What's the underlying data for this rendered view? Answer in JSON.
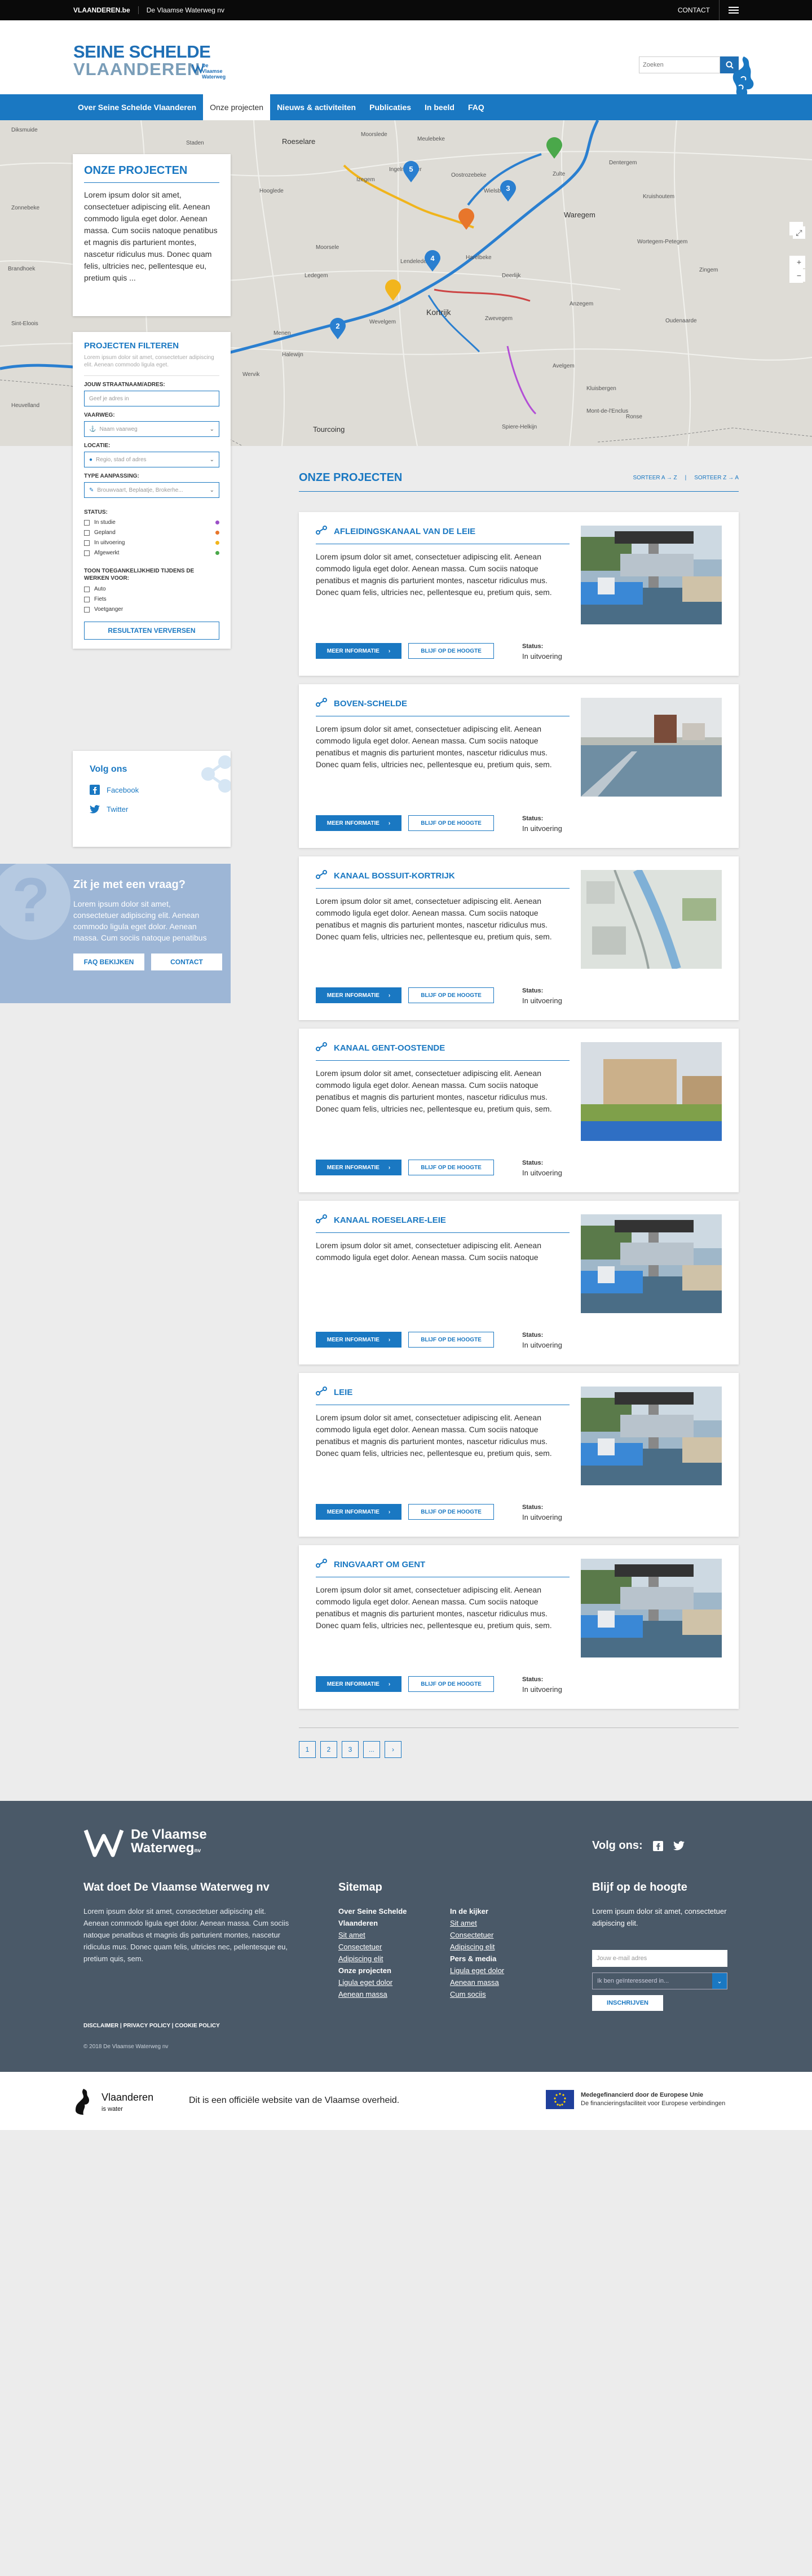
{
  "topbar": {
    "vlaanderen": "VLAANDEREN.be",
    "org": "De Vlaamse Waterweg nv",
    "contact": "CONTACT"
  },
  "header": {
    "title_line1": "SEINE SCHELDE",
    "title_line2": "VLAANDEREN",
    "partner": "De Vlaamse Waterweg",
    "search_placeholder": "Zoeken"
  },
  "nav": [
    "Over Seine Schelde Vlaanderen",
    "Onze projecten",
    "Nieuws & activiteiten",
    "Publicaties",
    "In beeld",
    "FAQ"
  ],
  "map": {
    "labels": [
      "Diksmuide",
      "Staden",
      "Roeselare",
      "Moorslede",
      "Meulebeke",
      "Oostrozebeke",
      "Zulte",
      "Izegem",
      "Wielsbeke",
      "Waregem",
      "Dentergem",
      "Ingelmunster",
      "Wervik",
      "Kortrijk",
      "Harelbeke",
      "Zwevegem",
      "Menen",
      "Wevelgem",
      "Deerlijk",
      "Avelgem",
      "Tourcoing",
      "Ronse",
      "Oudenaarde",
      "Anzegem",
      "Kluisbergen",
      "Spiere-Helkijn",
      "Sint-Eloois",
      "Halewijn",
      "Lendelede",
      "Hooglede",
      "Ledegem",
      "Moorsele",
      "Heuvelland",
      "Zonnebeke",
      "Kruishoutem",
      "Wortegem-Petegem",
      "Zingem",
      "Brandhoek",
      "Mont-de-l'Enclus"
    ],
    "markers": [
      "5",
      "3",
      "4",
      "2"
    ]
  },
  "intro": {
    "title": "ONZE PROJECTEN",
    "text": "Lorem ipsum dolor sit amet, consectetuer adipiscing elit. Aenean commodo ligula eget dolor. Aenean massa. Cum sociis natoque penatibus et magnis dis parturient montes, nascetur ridiculus mus. Donec quam felis, ultricies nec, pellentesque eu, pretium quis ..."
  },
  "filter": {
    "title": "PROJECTEN FILTEREN",
    "sub": "Lorem ipsum dolor sit amet, consectetuer adipiscing elit. Aenean commodo ligula eget.",
    "address_label": "JOUW STRAATNAAM/ADRES:",
    "address_placeholder": "Geef je adres in",
    "waterway_label": "VAARWEG:",
    "waterway_value": "Naam vaarweg",
    "location_label": "LOCATIE:",
    "location_value": "Regio, stad of adres",
    "type_label": "TYPE AANPASSING:",
    "type_value": "Brouwvaart, Beplaatje, Brokerhe...",
    "status_label": "STATUS:",
    "statuses": [
      {
        "label": "In studie",
        "color": "#9b4fc7"
      },
      {
        "label": "Gepland",
        "color": "#e8762b"
      },
      {
        "label": "In uitvoering",
        "color": "#f2b51d"
      },
      {
        "label": "Afgewerkt",
        "color": "#4aa84a"
      }
    ],
    "access_label": "TOON TOEGANKELIJKHEID TIJDENS DE WERKEN VOOR:",
    "access": [
      "Auto",
      "Fiets",
      "Voetganger"
    ],
    "button": "RESULTATEN VERVERSEN"
  },
  "follow": {
    "title": "Volg ons",
    "facebook": "Facebook",
    "twitter": "Twitter"
  },
  "question": {
    "title": "Zit je met een vraag?",
    "text": "Lorem ipsum dolor sit amet, consectetuer adipiscing elit. Aenean commodo ligula eget dolor. Aenean massa. Cum sociis natoque penatibus",
    "faq": "FAQ BEKIJKEN",
    "contact": "CONTACT"
  },
  "list": {
    "title": "ONZE PROJECTEN",
    "sort_az": "SORTEER A → Z",
    "sort_za": "SORTEER Z → A"
  },
  "projects": [
    {
      "title": "AFLEIDINGSKANAAL VAN DE LEIE",
      "desc": "Lorem ipsum dolor sit amet, consectetuer adipiscing elit. Aenean commodo ligula eget dolor. Aenean massa. Cum sociis natoque penatibus et magnis dis parturient montes, nascetur ridiculus mus. Donec quam felis, ultricies nec, pellentesque eu, pretium quis, sem.",
      "more": "MEER INFORMATIE",
      "follow": "BLIJF OP DE HOOGTE",
      "status_label": "Status:",
      "status": "In uitvoering",
      "img": "tower"
    },
    {
      "title": "BOVEN-SCHELDE",
      "desc": "Lorem ipsum dolor sit amet, consectetuer adipiscing elit. Aenean commodo ligula eget dolor. Aenean massa. Cum sociis natoque penatibus et magnis dis parturient montes, nascetur ridiculus mus. Donec quam felis, ultricies nec, pellentesque eu, pretium quis, sem.",
      "more": "MEER INFORMATIE",
      "follow": "BLIJF OP DE HOOGTE",
      "status_label": "Status:",
      "status": "In uitvoering",
      "img": "river"
    },
    {
      "title": "KANAAL BOSSUIT-KORTRIJK",
      "desc": "Lorem ipsum dolor sit amet, consectetuer adipiscing elit. Aenean commodo ligula eget dolor. Aenean massa. Cum sociis natoque penatibus et magnis dis parturient montes, nascetur ridiculus mus. Donec quam felis, ultricies nec, pellentesque eu, pretium quis, sem.",
      "more": "MEER INFORMATIE",
      "follow": "BLIJF OP DE HOOGTE",
      "status_label": "Status:",
      "status": "In uitvoering",
      "img": "aerial"
    },
    {
      "title": "KANAAL GENT-OOSTENDE",
      "desc": "Lorem ipsum dolor sit amet, consectetuer adipiscing elit. Aenean commodo ligula eget dolor. Aenean massa. Cum sociis natoque penatibus et magnis dis parturient montes, nascetur ridiculus mus. Donec quam felis, ultricies nec, pellentesque eu, pretium quis, sem.",
      "more": "MEER INFORMATIE",
      "follow": "BLIJF OP DE HOOGTE",
      "status_label": "Status:",
      "status": "In uitvoering",
      "img": "city"
    },
    {
      "title": "KANAAL ROESELARE-LEIE",
      "desc": "Lorem ipsum dolor sit amet, consectetuer adipiscing elit. Aenean commodo ligula eget dolor. Aenean massa. Cum sociis natoque",
      "more": "MEER INFORMATIE",
      "follow": "BLIJF OP DE HOOGTE",
      "status_label": "Status:",
      "status": "In uitvoering",
      "img": "tower"
    },
    {
      "title": "LEIE",
      "desc": "Lorem ipsum dolor sit amet, consectetuer adipiscing elit. Aenean commodo ligula eget dolor. Aenean massa. Cum sociis natoque penatibus et magnis dis parturient montes, nascetur ridiculus mus. Donec quam felis, ultricies nec, pellentesque eu, pretium quis, sem.",
      "more": "MEER INFORMATIE",
      "follow": "BLIJF OP DE HOOGTE",
      "status_label": "Status:",
      "status": "In uitvoering",
      "img": "tower"
    },
    {
      "title": "RINGVAART OM GENT",
      "desc": "Lorem ipsum dolor sit amet, consectetuer adipiscing elit. Aenean commodo ligula eget dolor. Aenean massa. Cum sociis natoque penatibus et magnis dis parturient montes, nascetur ridiculus mus. Donec quam felis, ultricies nec, pellentesque eu, pretium quis, sem.",
      "more": "MEER INFORMATIE",
      "follow": "BLIJF OP DE HOOGTE",
      "status_label": "Status:",
      "status": "In uitvoering",
      "img": "tower"
    }
  ],
  "pager": [
    "1",
    "2",
    "3",
    "...",
    "›"
  ],
  "footer": {
    "logo_line1": "De Vlaamse",
    "logo_line2": "Waterweg",
    "logo_nv": "nv",
    "follow": "Volg ons:",
    "about_title": "Wat doet De Vlaamse Waterweg nv",
    "about_text": "Lorem ipsum dolor sit amet, consectetuer adipiscing elit. Aenean commodo ligula eget dolor. Aenean massa. Cum sociis natoque penatibus et magnis dis parturient montes, nascetur ridiculus mus. Donec quam felis, ultricies nec, pellentesque eu, pretium quis, sem.",
    "sitemap_title": "Sitemap",
    "sm1_head": "Over Seine Schelde Vlaanderen",
    "sm1": [
      "Sit amet",
      "Consectetuer",
      "Adipiscing elit"
    ],
    "sm2_head": "Onze projecten",
    "sm2": [
      "Ligula eget dolor",
      "Aenean massa"
    ],
    "sm3_head": "In de kijker",
    "sm3": [
      "Sit amet",
      "Consectetuer",
      "Adipiscing elit"
    ],
    "sm4_head": "Pers & media",
    "sm4": [
      "Ligula eget dolor",
      "Aenean massa",
      "Cum sociis"
    ],
    "news_title": "Blijf op de hoogte",
    "news_text": "Lorem ipsum dolor sit amet, consectetuer adipiscing elit.",
    "email_placeholder": "Jouw e-mail adres",
    "select": "Ik ben geïnteresseerd in...",
    "subscribe": "INSCHRIJVEN",
    "legal": "DISCLAIMER | PRIVACY POLICY | COOKIE POLICY",
    "copyright": "© 2018 De Vlaamse Waterweg nv"
  },
  "bottom": {
    "vl": "Vlaanderen",
    "vl_sub": "is water",
    "official": "Dit is een officiële website van de Vlaamse overheid.",
    "eu1": "Medegefinancierd door de Europese Unie",
    "eu2": "De financieringsfaciliteit voor Europese verbindingen"
  }
}
